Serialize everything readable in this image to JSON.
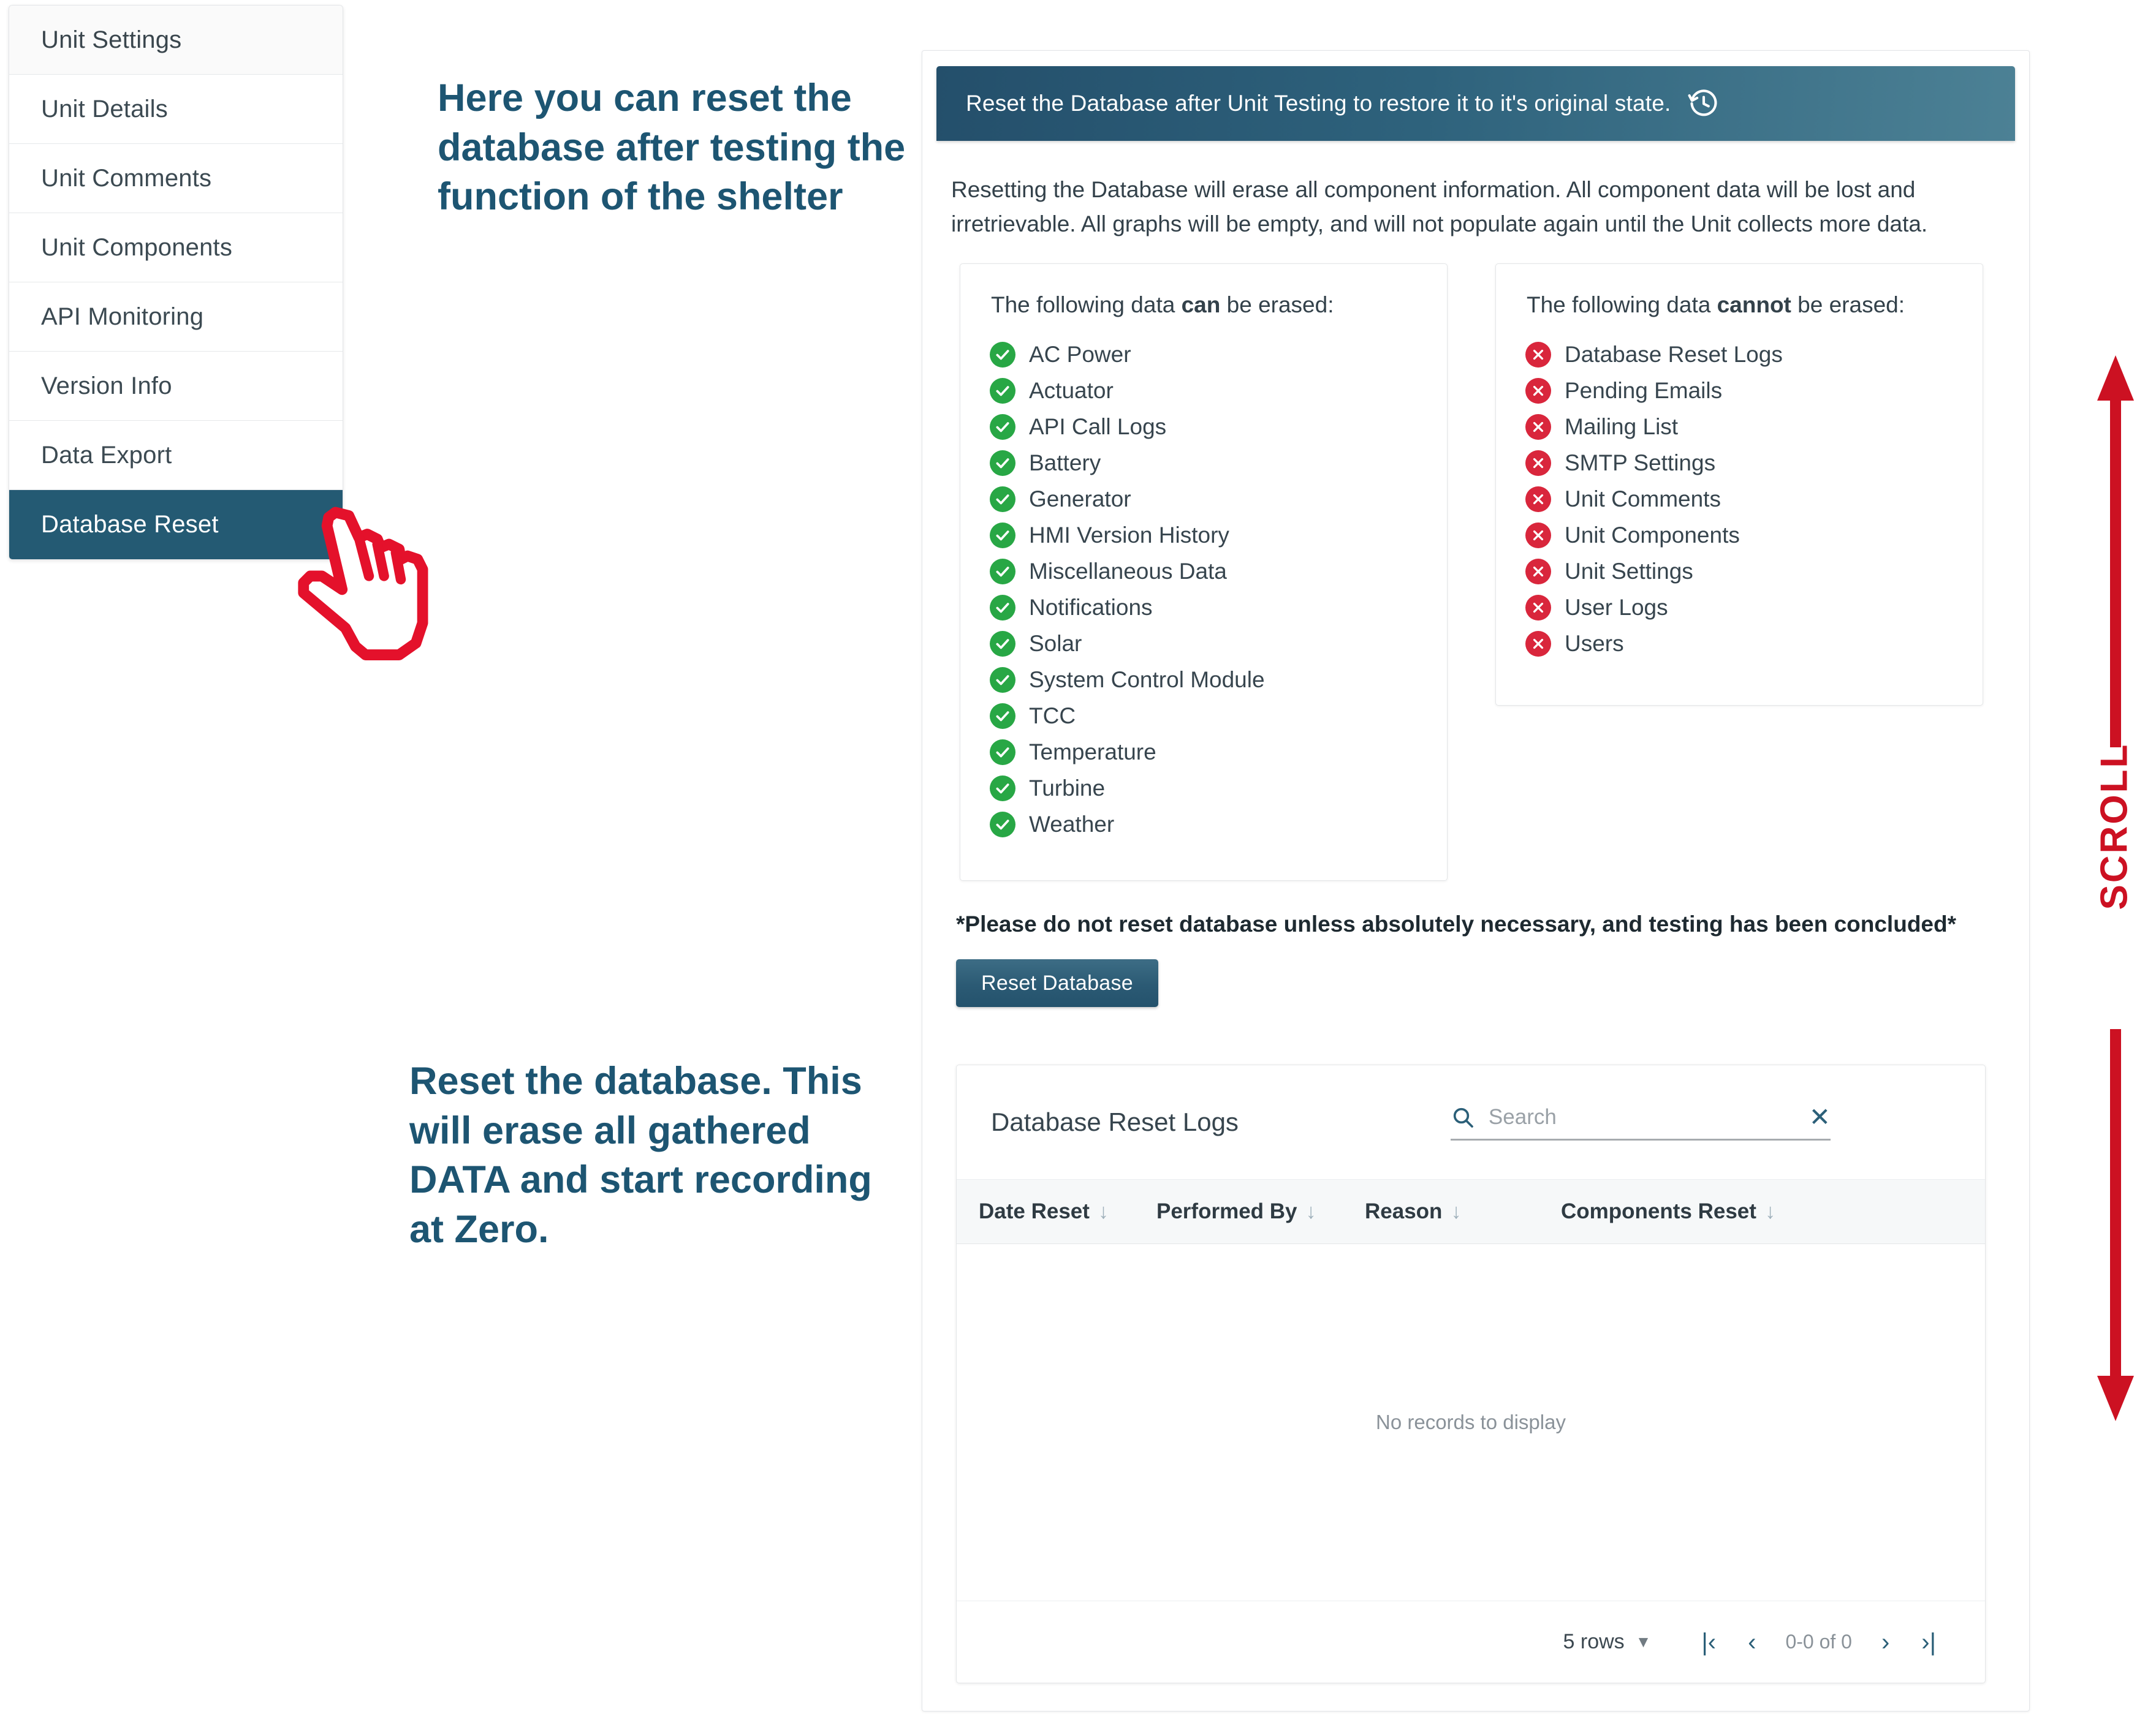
{
  "sidebar": {
    "items": [
      {
        "label": "Unit Settings",
        "state": "header"
      },
      {
        "label": "Unit Details",
        "state": "normal"
      },
      {
        "label": "Unit Comments",
        "state": "normal"
      },
      {
        "label": "Unit Components",
        "state": "normal"
      },
      {
        "label": "API Monitoring",
        "state": "normal"
      },
      {
        "label": "Version Info",
        "state": "normal"
      },
      {
        "label": "Data Export",
        "state": "normal"
      },
      {
        "label": "Database Reset",
        "state": "active"
      }
    ]
  },
  "annotations": {
    "top": "Here you can reset the database after testing the function of the shelter",
    "bottom": "Reset the database. This will erase all gathered DATA and start recording at Zero.",
    "scroll_label": "SCROLL",
    "accent_color": "#1d5572",
    "marker_color": "#cc1122",
    "cursor_icon": "hand-pointer-icon"
  },
  "panel": {
    "header_title": "Reset the Database after Unit Testing to restore it to it's original state.",
    "header_icon": "history-clock-icon",
    "intro": "Resetting the Database will erase all component information. All component data will be lost and irretrievable. All graphs will be empty, and will not populate again until the Unit collects more data.",
    "warning": "*Please do not reset database unless absolutely necessary, and testing has been concluded*",
    "reset_button": "Reset Database",
    "header_gradient_from": "#244f6b",
    "header_gradient_to": "#4c8195"
  },
  "can_erase": {
    "title_pre": "The following data ",
    "title_bold": "can",
    "title_post": " be erased:",
    "badge_color": "#28a745",
    "items": [
      "AC Power",
      "Actuator",
      "API Call Logs",
      "Battery",
      "Generator",
      "HMI Version History",
      "Miscellaneous Data",
      "Notifications",
      "Solar",
      "System Control Module",
      "TCC",
      "Temperature",
      "Turbine",
      "Weather"
    ]
  },
  "cannot_erase": {
    "title_pre": "The following data ",
    "title_bold": "cannot",
    "title_post": " be erased:",
    "badge_color": "#d9263c",
    "items": [
      "Database Reset Logs",
      "Pending Emails",
      "Mailing List",
      "SMTP Settings",
      "Unit Comments",
      "Unit Components",
      "Unit Settings",
      "User Logs",
      "Users"
    ]
  },
  "logs": {
    "title": "Database Reset Logs",
    "search_placeholder": "Search",
    "search_value": "",
    "clear_label": "✕",
    "columns": [
      {
        "label": "Date Reset",
        "sort": "↓"
      },
      {
        "label": "Performed By",
        "sort": "↓"
      },
      {
        "label": "Reason",
        "sort": "↓"
      },
      {
        "label": "Components Reset",
        "sort": "↓"
      }
    ],
    "rows": [],
    "empty_message": "No records to display",
    "footer": {
      "rows_per_page": "5 rows",
      "range": "0-0 of 0",
      "first_label": "|‹",
      "prev_label": "‹",
      "next_label": "›",
      "last_label": "›|"
    }
  }
}
